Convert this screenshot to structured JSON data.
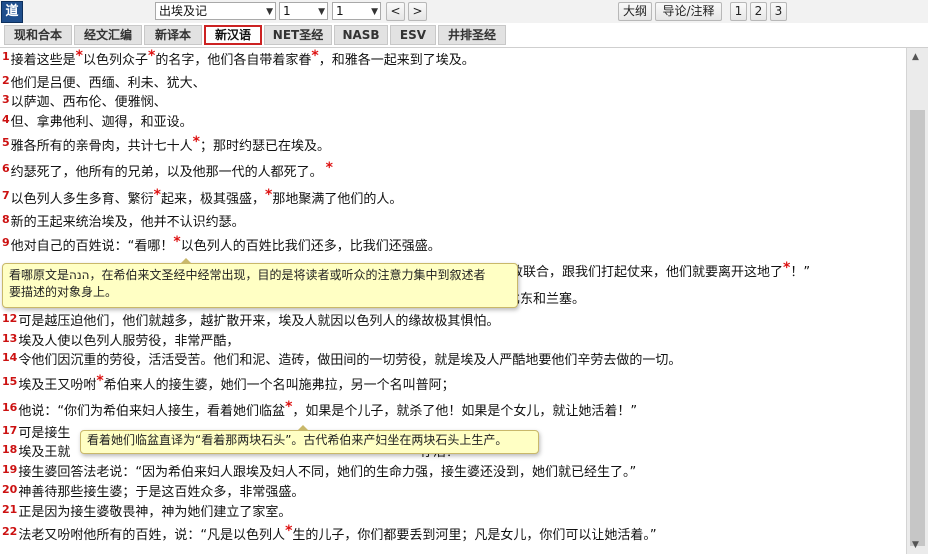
{
  "toolbar": {
    "logo": "道",
    "book": "出埃及记",
    "chapter": "1",
    "verse": "1",
    "prev": "<",
    "next": ">",
    "outline": "大纲",
    "notes": "导论/注释",
    "pages": [
      "1",
      "2",
      "3"
    ]
  },
  "tabs": [
    "现和合本",
    "经文汇编",
    "新译本",
    "新汉语",
    "NET圣经",
    "NASB",
    "ESV",
    "井排圣经"
  ],
  "active_tab": "新汉语",
  "verses": [
    {
      "num": "1",
      "parts": [
        "接着这些是",
        "以色列众子",
        "的名字，他们各自带着家眷",
        "，和雅各一起来到了埃及。"
      ]
    },
    {
      "num": "2",
      "parts": [
        "他们是吕便、西缅、利未、犹大、"
      ]
    },
    {
      "num": "3",
      "parts": [
        "以萨迦、西布伦、便雅悯、"
      ]
    },
    {
      "num": "4",
      "parts": [
        "但、拿弗他利、迦得，和亚设。"
      ]
    },
    {
      "num": "5",
      "parts": [
        "雅各所有的亲骨肉，共计七十人",
        "；那时约瑟已在埃及。"
      ]
    },
    {
      "num": "6",
      "parts": [
        "约瑟死了，他所有的兄弟，以及他那一代的人都死了。"
      ]
    },
    {
      "num": "7",
      "parts": [
        "以色列人多生多育、繁衍",
        "起来，极其强盛，",
        "那地聚满了他们的人。"
      ]
    },
    {
      "num": "8",
      "parts": [
        "新的王起来统治埃及，他并不认识约瑟。"
      ]
    },
    {
      "num": "9",
      "parts": [
        "他对自己的百姓说：“看哪！",
        "以色列人的百姓比我们还多，比我们还强盛。"
      ]
    },
    {
      "num": "10",
      "parts": [
        "",
        "致联合，跟我们打起仗来，他们就要离开这地了",
        "！”"
      ]
    },
    {
      "num": "11",
      "parts": [
        "",
        "比东和兰塞。"
      ]
    },
    {
      "num": "12",
      "parts": [
        "可是越压迫他们，他们就越多，越扩散开来，埃及人就因以色列人的缘故极其惧怕。"
      ]
    },
    {
      "num": "13",
      "parts": [
        "埃及人使以色列人服劳役，非常严酷，"
      ]
    },
    {
      "num": "14",
      "parts": [
        "令他们因沉重的劳役，活活受苦。他们和泥、造砖，做田间的一切劳役，就是埃及人严酷地要他们辛劳去做的一切。"
      ]
    },
    {
      "num": "15",
      "parts": [
        "埃及王又吩咐",
        "希伯来人的接生婆，她们一个名叫施弗拉，另一个名叫普阿；"
      ]
    },
    {
      "num": "16",
      "parts": [
        "他说：“你们为希伯来妇人接生，看着她们临盆",
        "，如果是个儿子，就杀了他！如果是个女儿，就让她活着！”"
      ]
    },
    {
      "num": "17",
      "parts": [
        "可是接生"
      ]
    },
    {
      "num": "18",
      "parts": [
        "埃及王就",
        "存活？”"
      ]
    },
    {
      "num": "19",
      "parts": [
        "接生婆回答法老说：“因为希伯来妇人跟埃及妇人不同，她们的生命力强，接生婆还没到，她们就已经生了。”"
      ]
    },
    {
      "num": "20",
      "parts": [
        "神善待那些接生婆；于是这百姓众多，非常强盛。"
      ]
    },
    {
      "num": "21",
      "parts": [
        "正是因为接生婆敬畏神，神为她们建立了家室。"
      ]
    },
    {
      "num": "22",
      "parts": [
        "法老又吩咐他所有的百姓，说：“凡是以色列人",
        "生的儿子，你们都要丢到河里；凡是女儿，你们可以让她活着。”"
      ]
    }
  ],
  "star_symbol": "*",
  "tooltips": [
    {
      "text_line1": "看哪原文是הנה，在希伯来文圣经中经常出现，目的是将读者或听众的注意力集中到叙述者",
      "text_line2": "要描述的对象身上。"
    },
    {
      "text_line1": "看着她们临盆直译为“看着那两块石头”。古代希伯来产妇坐在两块石头上生产。"
    }
  ],
  "colors": {
    "verse_number": "#cc1111",
    "tooltip_bg": "#ffffc4",
    "active_tab_border": "#cc2222"
  }
}
